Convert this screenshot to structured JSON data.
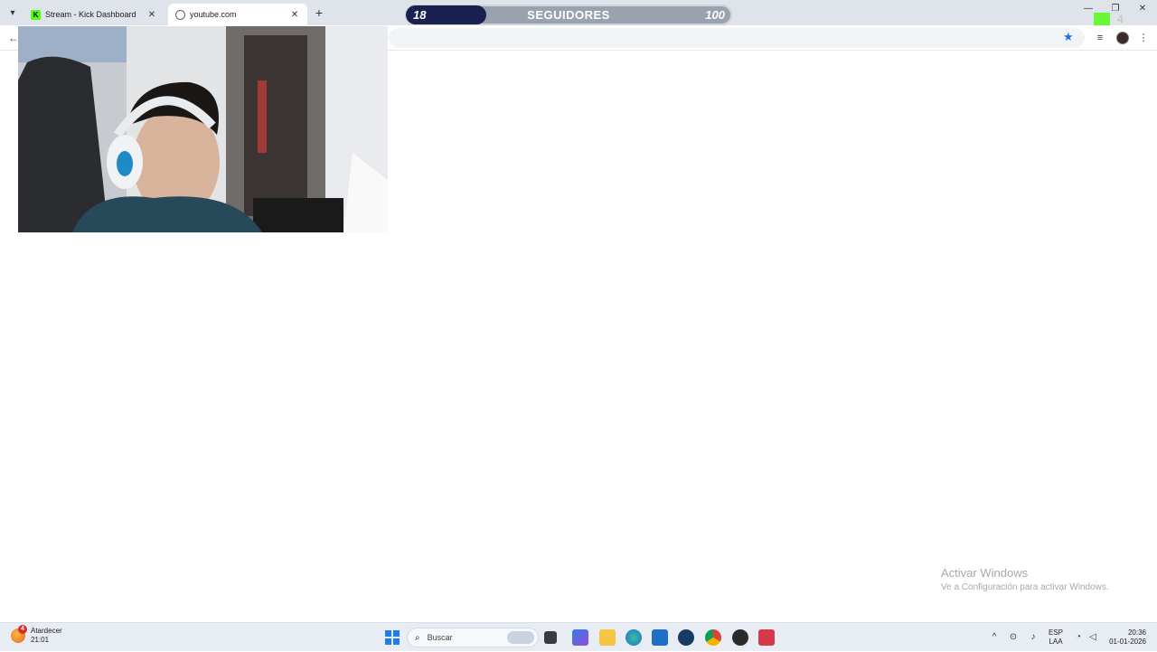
{
  "browser": {
    "tabs": [
      {
        "title": "Stream - Kick Dashboard",
        "favicon": "kick-icon",
        "active": false
      },
      {
        "title": "youtube.com",
        "favicon": "globe-icon",
        "active": true
      }
    ],
    "new_tab_symbol": "+",
    "close_symbol": "✕"
  },
  "overlay": {
    "followers_current": "18",
    "followers_label": "SEGUIDORES",
    "followers_goal": "100",
    "followers_progress": 0.18,
    "mini_count": "4"
  },
  "watermark": {
    "line1": "Activar Windows",
    "line2": "Ve a Configuración para activar Windows."
  },
  "taskbar": {
    "weather_label": "Atardecer",
    "weather_time": "21:01",
    "weather_badge": "4",
    "search_placeholder": "Buscar",
    "language_top": "ESP",
    "language_bottom": "LAA",
    "clock_time": "20:36",
    "clock_date": "01-01-2026"
  },
  "colors": {
    "accent_kick": "#53fc18",
    "progress_fill": "#1a2150",
    "taskbar_bg": "#e8ecf3"
  }
}
